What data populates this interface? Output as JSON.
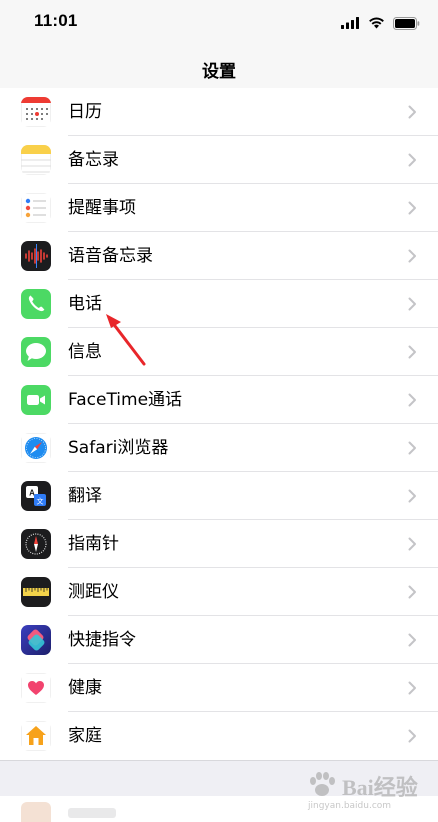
{
  "status_bar": {
    "time": "11:01"
  },
  "nav": {
    "title": "设置"
  },
  "rows": [
    {
      "label": "日历",
      "icon": "calendar-icon"
    },
    {
      "label": "备忘录",
      "icon": "notes-icon"
    },
    {
      "label": "提醒事项",
      "icon": "reminders-icon"
    },
    {
      "label": "语音备忘录",
      "icon": "voice-memos-icon"
    },
    {
      "label": "电话",
      "icon": "phone-icon"
    },
    {
      "label": "信息",
      "icon": "messages-icon"
    },
    {
      "label": "FaceTime通话",
      "icon": "facetime-icon"
    },
    {
      "label": "Safari浏览器",
      "icon": "safari-icon"
    },
    {
      "label": "翻译",
      "icon": "translate-icon"
    },
    {
      "label": "指南针",
      "icon": "compass-icon"
    },
    {
      "label": "测距仪",
      "icon": "measure-icon"
    },
    {
      "label": "快捷指令",
      "icon": "shortcuts-icon"
    },
    {
      "label": "健康",
      "icon": "health-icon"
    },
    {
      "label": "家庭",
      "icon": "home-icon"
    }
  ],
  "watermark": {
    "text": "Bai经验",
    "url": "jingyan.baidu.com"
  },
  "colors": {
    "annotation_arrow": "#e8262a",
    "chevron": "#c4c4c7"
  }
}
